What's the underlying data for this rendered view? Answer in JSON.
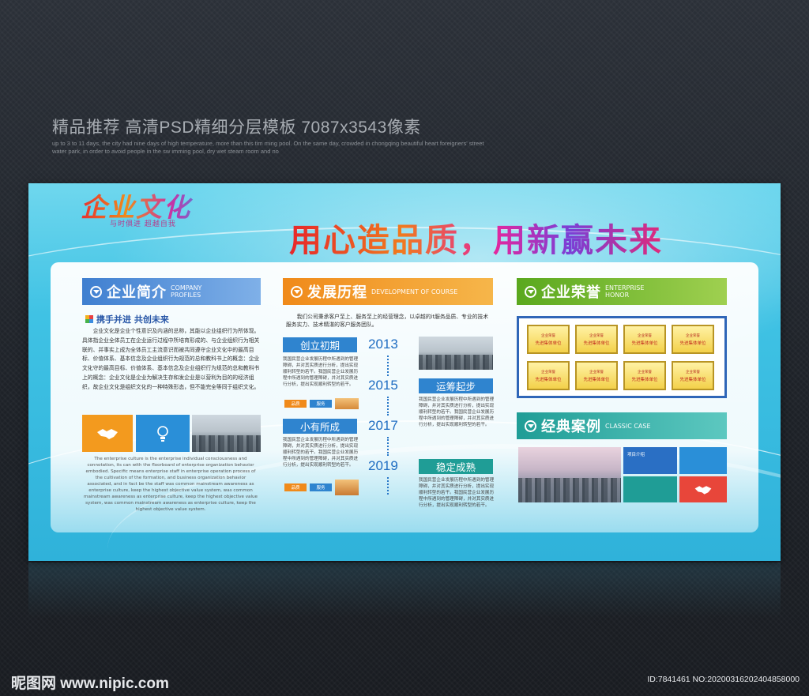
{
  "header": {
    "title": "精品推荐 高清PSD精细分层模板 7087x3543像素",
    "sub": "up to 3 to 11 days, the city had nine days of high temperature, more than this tim ming pool. On the same day, crowded in chongqing beautiful heart foreigners' street water park, in order to avoid people in the sw imming pool, dry wet steam room and no"
  },
  "board": {
    "logo": "企业文化",
    "logo_tagline": "与时俱进 超越自我",
    "slogan": "用心造品质，用新赢未来"
  },
  "profile": {
    "title": "企业简介",
    "title_en": "COMPANY PROFILES",
    "subtitle": "携手并进 共创未来",
    "body": "企业文化是企业个性意识及内涵的总称，其能以企业组织行为所体现。具体指企业全体员工在企业运行过程中所培育形成的、与企业组织行为相关联的、并事实上成为全体员工主流意识而被共同遵守企业文化中的最高目标、价值体系、基本信念及企业组织行为规范的总和教科书上的概念：企业文化守的最高目标、价值体系、基本信念及企业组织行为规范的总和教科书上的概念：企业文化是企业为解决生存和发企业是以营利为目的的经济组织，故企业文化是组织文化的一种特殊形态，但不能完全等同于组织文化。",
    "english": "The enterprise culture is the enterprise individual consciousness and connotation, its can with the floorboard of enterprise organization behavior embodied. Specific means enterprise staff in enterprise operation process of the cultivation of the formation, and business organization behavior associated, and in fact be the staff was common mainstream awareness as enterprise culture, keep the highest objective value system, was common mainstream awareness as enterprise culture, keep the highest objective value system, was common mainstream awareness as enterprise culture, keep the highest objective value system."
  },
  "history": {
    "title": "发展历程",
    "title_en": "DEVELOPMENT OF COURSE",
    "intro": "我们公司秉承客户至上、服务至上的经营理念，以卓越的it服务品质、专业的技术服务实力、技术精湛的客户服务团队。",
    "milestones": [
      {
        "label": "创立初期",
        "year": "2013"
      },
      {
        "label": "运筹起步",
        "year": "2015"
      },
      {
        "label": "小有所成",
        "year": "2017"
      },
      {
        "label": "稳定成熟",
        "year": "2019"
      }
    ],
    "blurb": "我国民营企业发展历程中所遇到的管理障碍，并对其实质进行分析，提出实现顺利转型的若干。我国民营企业发展历程中所遇到的管理障碍，并对其实质进行分析，提出实现顺利转型的若干。",
    "chip1": "品质",
    "chip2": "服务"
  },
  "honor": {
    "title": "企业荣誉",
    "title_en": "ENTERPRISE HONOR",
    "cert_top": "企业荣誉",
    "cert_main": "先进集体单位"
  },
  "cases": {
    "title": "经典案例",
    "title_en": "CLASSIC CASE",
    "tile_label": "项目介绍"
  },
  "footer": {
    "logo": "昵图网 www.nipic.com",
    "id": "ID:7841461 NO:20200316202404858000"
  },
  "colors": {
    "blue": "#3f7fd0",
    "orange": "#f08a1a",
    "green": "#5aa81e",
    "teal": "#1f9d96",
    "sky": "#3fc2e4"
  },
  "icons": [
    "handshake-icon",
    "lightbulb-icon",
    "handshake-icon"
  ]
}
